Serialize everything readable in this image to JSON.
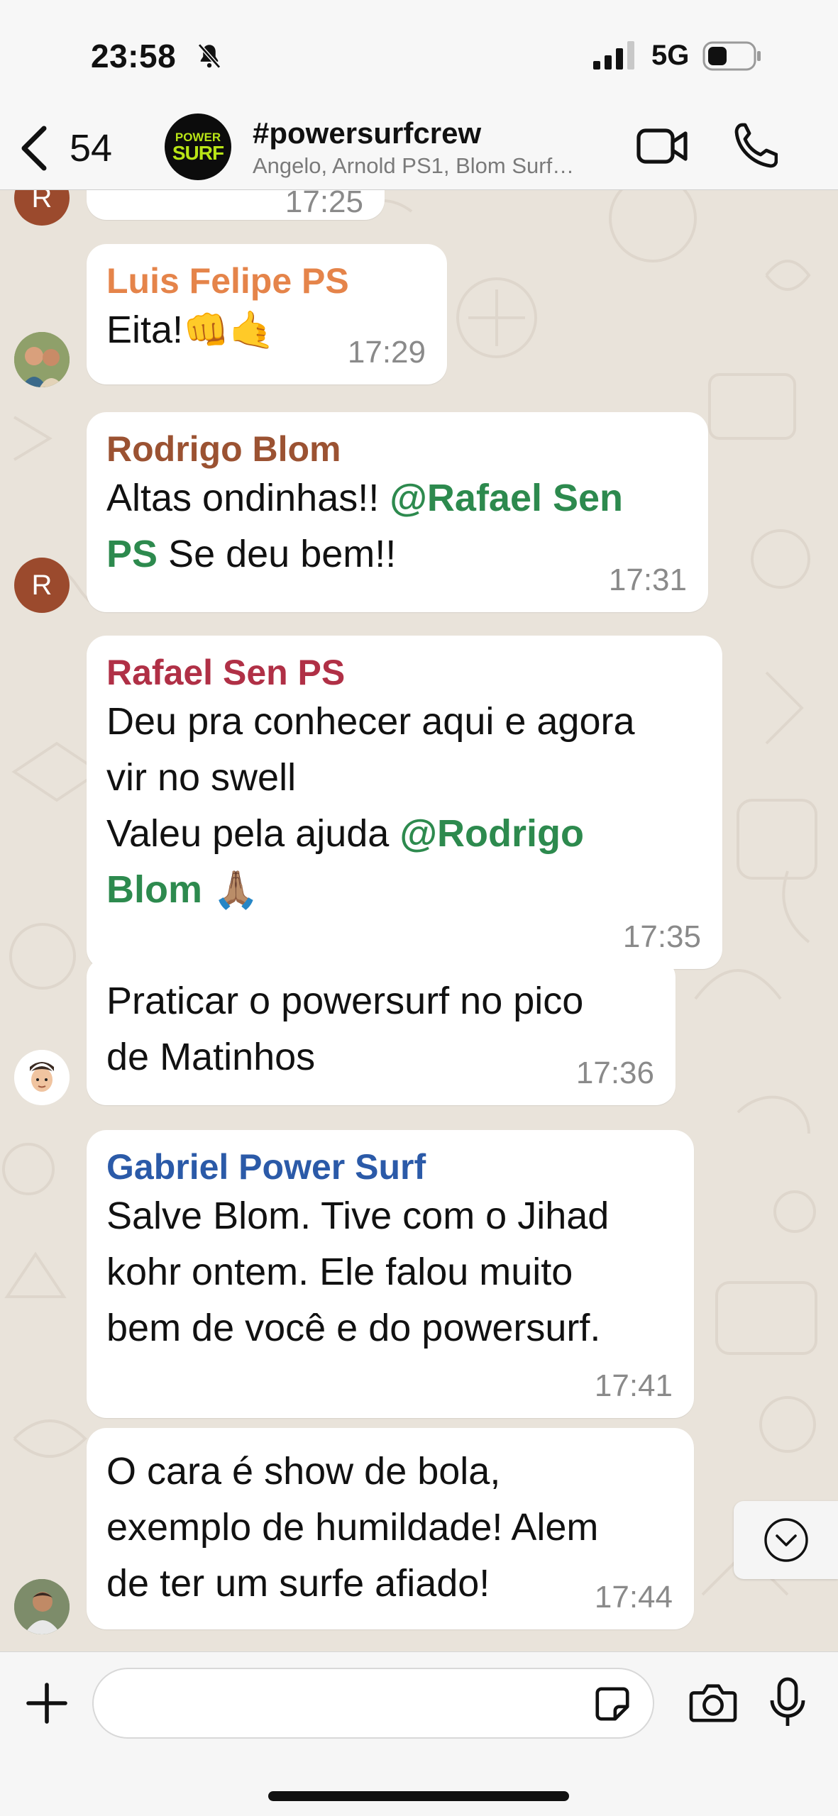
{
  "status_bar": {
    "time": "23:58",
    "network": "5G",
    "icons": [
      "bell-off-icon",
      "signal-icon",
      "battery-icon"
    ]
  },
  "header": {
    "back_count": "54",
    "group_avatar_line1": "POWER",
    "group_avatar_line2": "SURF",
    "title": "#powersurfcrew",
    "subtitle": "Angelo, Arnold PS1, Blom Surf…"
  },
  "colors": {
    "chat_background": "#e9e3da",
    "bubble": "#ffffff",
    "mention": "#2d8a4e",
    "sender_luis": "#e5844a",
    "sender_rodrigo": "#9b5232",
    "sender_rafael": "#b03046",
    "sender_gabriel": "#2b5aa8"
  },
  "messages": [
    {
      "avatar_letter": "R",
      "time": "17:25"
    },
    {
      "sender": "Luis Felipe PS",
      "text": "Eita!",
      "emojis": "👊🤙",
      "time": "17:29"
    },
    {
      "sender": "Rodrigo Blom",
      "text_1": "Altas ondinhas!! ",
      "mention_1": "@Rafael Sen",
      "mention_2": "PS",
      "text_2": " Se deu bem!!",
      "time": "17:31",
      "avatar_letter": "R"
    },
    {
      "sender": "Rafael Sen PS",
      "line_1": "Deu pra conhecer aqui e agora",
      "line_2": "vir no swell",
      "line_3": "Valeu pela ajuda ",
      "mention_1": "@Rodrigo",
      "mention_2": "Blom",
      "emoji": "🙏🏽",
      "time": "17:35"
    },
    {
      "line_1": "Praticar o powersurf no pico",
      "line_2": "de Matinhos",
      "time": "17:36"
    },
    {
      "sender": "Gabriel Power Surf",
      "line_1": "Salve Blom. Tive com o Jihad",
      "line_2": "kohr ontem. Ele falou muito",
      "line_3": "bem de você e do powersurf.",
      "time": "17:41"
    },
    {
      "line_1": "O cara é show de bola,",
      "line_2": "exemplo de humildade! Alem",
      "line_3": "de ter um surfe afiado!",
      "time": "17:44"
    }
  ],
  "input": {
    "placeholder": ""
  }
}
